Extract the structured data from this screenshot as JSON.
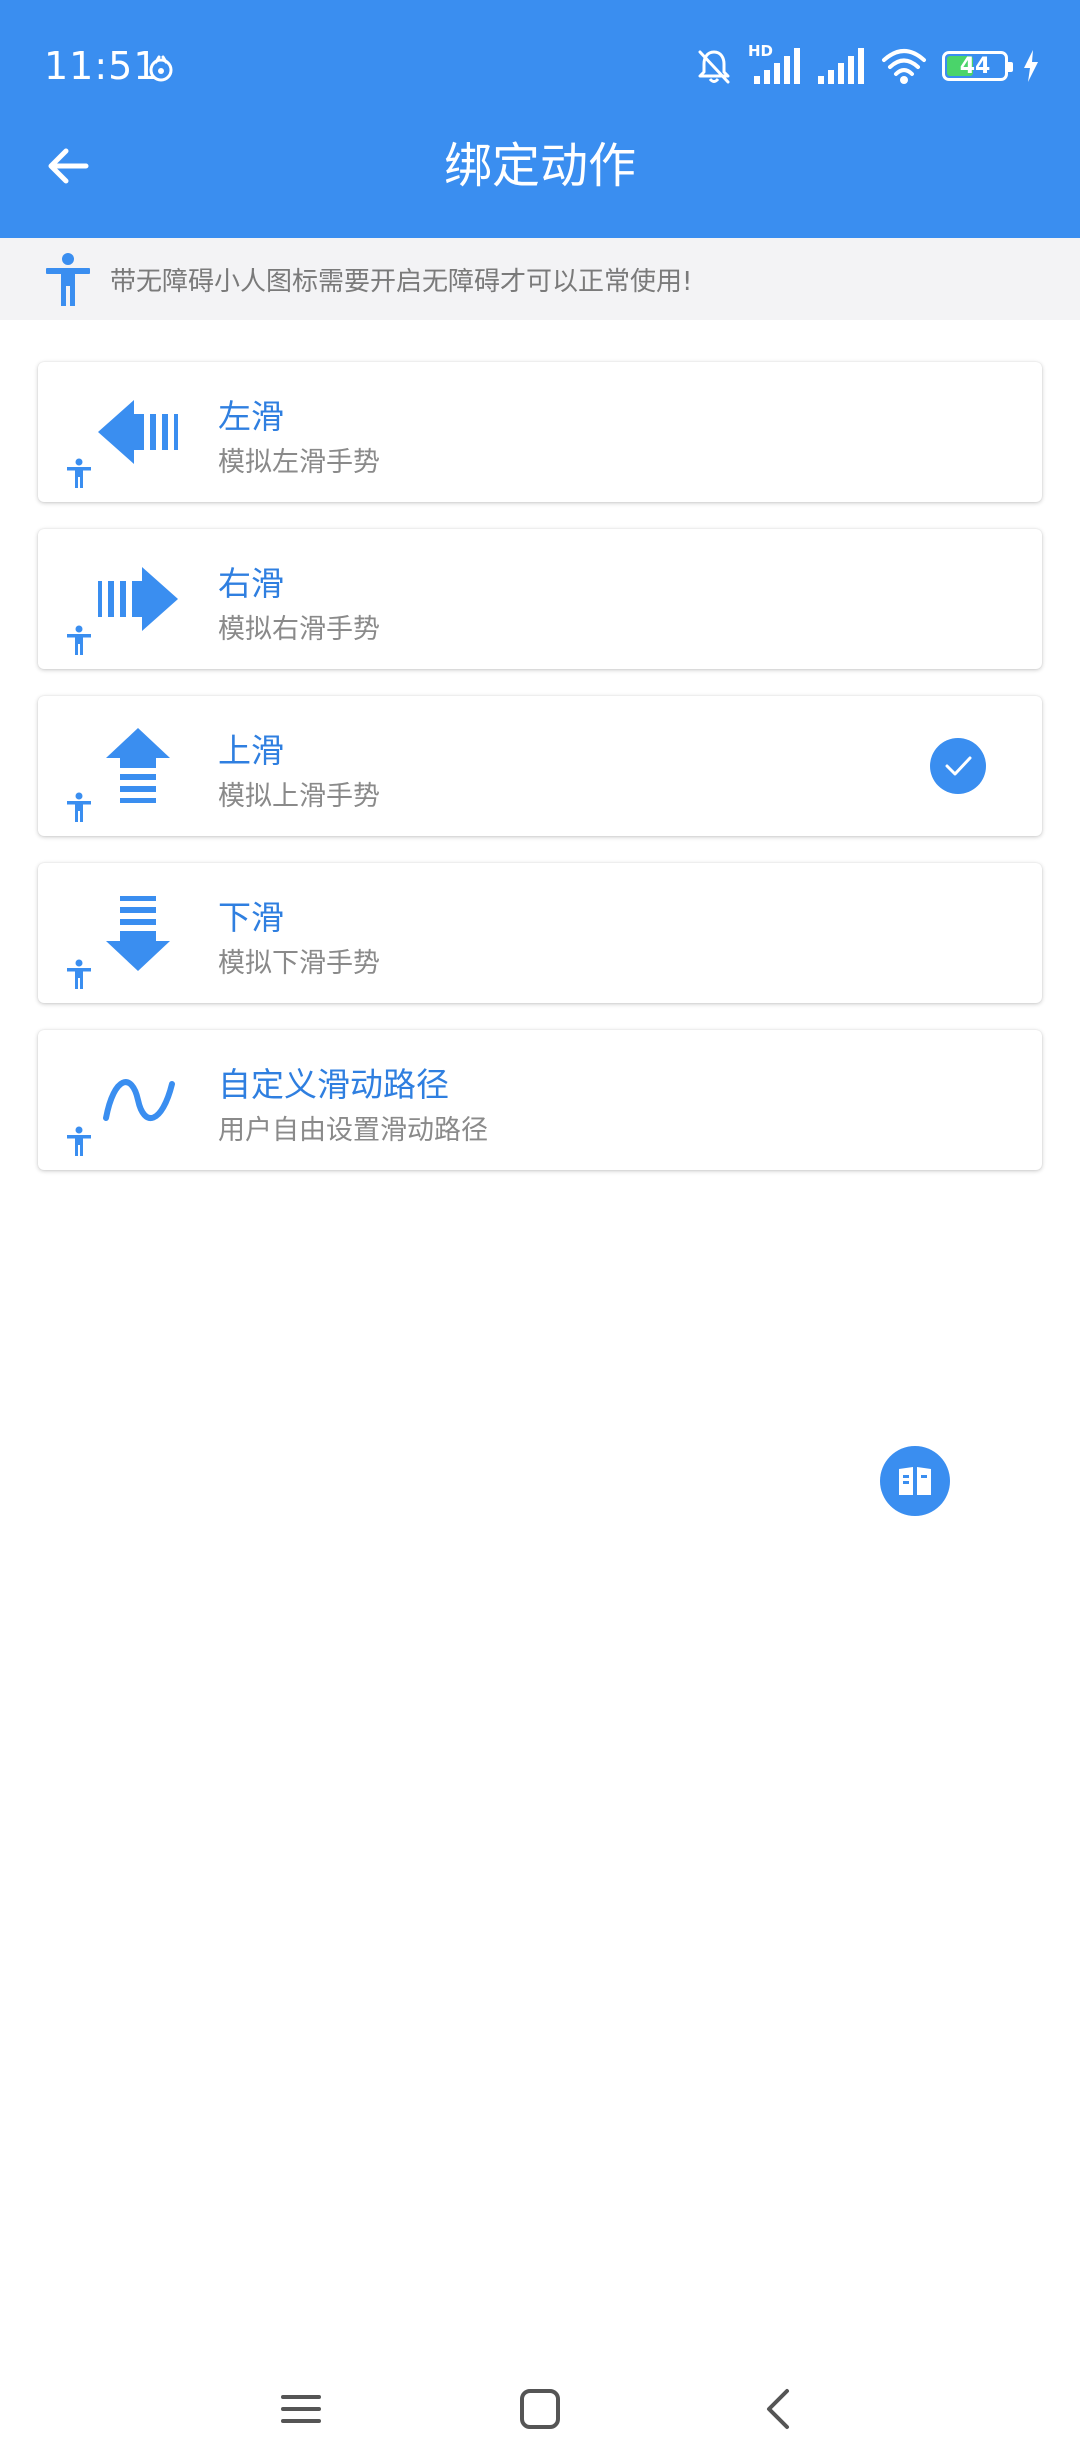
{
  "status_bar": {
    "time": "11:51",
    "network_badge": "HD",
    "battery": "44",
    "battery_level": 0.44,
    "icons": [
      "app-notification-icon",
      "bell-muted-icon",
      "signal-hd-icon",
      "signal-icon",
      "wifi-icon",
      "battery-icon",
      "charging-icon"
    ]
  },
  "header": {
    "title": "绑定动作",
    "back_icon": "arrow-left-icon"
  },
  "notice": {
    "icon": "accessibility-person-icon",
    "text": "带无障碍小人图标需要开启无障碍才可以正常使用!"
  },
  "actions": [
    {
      "title": "左滑",
      "subtitle": "模拟左滑手势",
      "icon": "swipe-left-arrow-icon",
      "badge_icon": "accessibility-person-icon",
      "selected": false
    },
    {
      "title": "右滑",
      "subtitle": "模拟右滑手势",
      "icon": "swipe-right-arrow-icon",
      "badge_icon": "accessibility-person-icon",
      "selected": false
    },
    {
      "title": "上滑",
      "subtitle": "模拟上滑手势",
      "icon": "swipe-up-arrow-icon",
      "badge_icon": "accessibility-person-icon",
      "selected": true
    },
    {
      "title": "下滑",
      "subtitle": "模拟下滑手势",
      "icon": "swipe-down-arrow-icon",
      "badge_icon": "accessibility-person-icon",
      "selected": false
    },
    {
      "title": "自定义滑动路径",
      "subtitle": "用户自由设置滑动路径",
      "icon": "custom-path-wave-icon",
      "badge_icon": "accessibility-person-icon",
      "selected": false
    }
  ],
  "selected_icon": "check-circle-icon",
  "fab": {
    "icon": "book-icon"
  },
  "nav_bar": {
    "icons": [
      "menu-icon",
      "home-square-icon",
      "back-chevron-icon"
    ]
  },
  "colors": {
    "primary": "#3a8ef0",
    "title_blue": "#2f7fe0",
    "notice_bg": "#f3f3f5",
    "subtitle_gray": "#8a8a8a"
  }
}
